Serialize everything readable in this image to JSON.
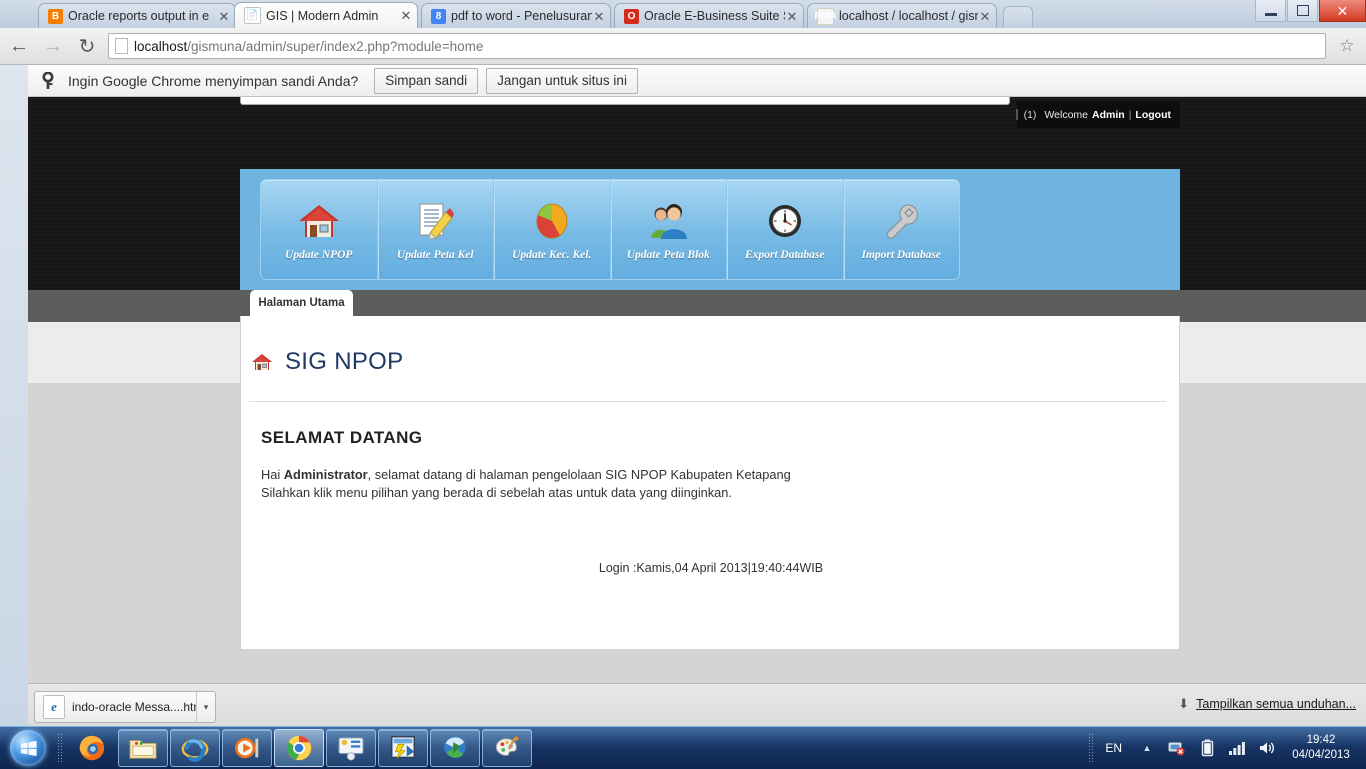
{
  "browser": {
    "tabs": [
      {
        "title": "Oracle reports output in e",
        "icon": "blogger-icon",
        "active": false
      },
      {
        "title": "GIS | Modern Admin",
        "icon": "page-icon",
        "active": true
      },
      {
        "title": "pdf to word - Penelusuran",
        "icon": "google-icon",
        "active": false
      },
      {
        "title": "Oracle E-Business Suite Sy",
        "icon": "oracle-icon",
        "active": false
      },
      {
        "title": "localhost / localhost / gisr",
        "icon": "phpmyadmin-icon",
        "active": false
      }
    ],
    "close_label": "✕",
    "url_host": "localhost",
    "url_rest": "/gismuna/admin/super/index2.php?module=home",
    "back_glyph": "←",
    "forward_glyph": "→",
    "reload_glyph": "↻",
    "star_glyph": "☆",
    "infobar": {
      "question": "Ingin Google Chrome menyimpan sandi Anda?",
      "save_label": "Simpan sandi",
      "never_label": "Jangan untuk situs ini"
    },
    "window": {
      "minimize": "─",
      "restore": "❐",
      "close": "✕"
    }
  },
  "site": {
    "welcome_bar": {
      "count": "(1)",
      "welcome": "Welcome",
      "user": "Admin",
      "separator": "|",
      "logout": "Logout"
    },
    "menu": [
      {
        "label": "Update NPOP",
        "icon": "home-icon"
      },
      {
        "label": "Update Peta Kel",
        "icon": "document-edit-icon"
      },
      {
        "label": "Update Kec. Kel.",
        "icon": "pie-chart-icon"
      },
      {
        "label": "Update Peta Blok",
        "icon": "users-icon"
      },
      {
        "label": "Export Database",
        "icon": "clock-icon"
      },
      {
        "label": "Import Database",
        "icon": "wrench-icon"
      }
    ],
    "tab_label": "Halaman Utama",
    "page_title": "SIG NPOP",
    "welcome_heading": "SELAMAT DATANG",
    "welcome_line1_pre": "Hai ",
    "welcome_line1_bold": "Administrator",
    "welcome_line1_post": ", selamat datang di halaman pengelolaan SIG NPOP Kabupaten Ketapang",
    "welcome_line2": "Silahkan klik menu pilihan yang berada di sebelah atas untuk data yang diinginkan.",
    "login_line": "Login :Kamis,04 April 2013|19:40:44WIB"
  },
  "downloads": {
    "file_name": "indo-oracle  Messa....htm",
    "file_icon": "internet-explorer-icon",
    "caret": "▾",
    "show_all": "Tampilkan semua unduhan...",
    "arrow": "⬇"
  },
  "taskbar": {
    "items": [
      {
        "name": "firefox-icon",
        "state": "pinned"
      },
      {
        "name": "file-explorer-icon",
        "state": "framed"
      },
      {
        "name": "internet-explorer-icon",
        "state": "framed"
      },
      {
        "name": "media-player-icon",
        "state": "framed"
      },
      {
        "name": "chrome-icon",
        "state": "active"
      },
      {
        "name": "control-panel-icon",
        "state": "framed"
      },
      {
        "name": "xampp-icon",
        "state": "framed"
      },
      {
        "name": "idm-icon",
        "state": "framed"
      },
      {
        "name": "paint-icon",
        "state": "framed"
      }
    ],
    "tray": {
      "language": "EN",
      "show_hidden": "▲",
      "icons": [
        "network-error-icon",
        "battery-icon",
        "signal-icon",
        "volume-icon"
      ],
      "time": "19:42",
      "date": "04/04/2013"
    }
  },
  "colors": {
    "panel_blue": "#6fb3e0",
    "title_navy": "#1f3864",
    "header_dark": "#171717",
    "grey_band": "#5d5d5d"
  }
}
